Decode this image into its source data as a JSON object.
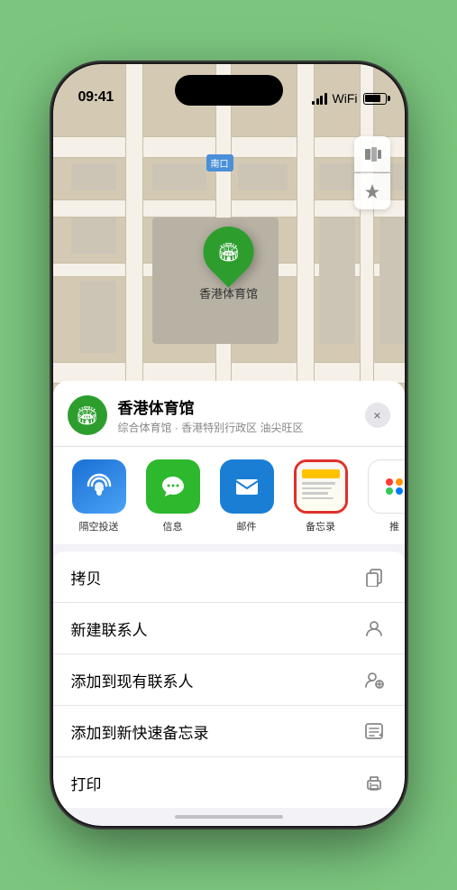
{
  "status_bar": {
    "time": "09:41",
    "location_arrow": "▶"
  },
  "map": {
    "station_label": "南口",
    "venue_name": "香港体育馆",
    "venue_label": "香港体育馆"
  },
  "sheet": {
    "venue_name": "香港体育馆",
    "venue_sub": "综合体育馆 · 香港特别行政区 油尖旺区",
    "close_label": "×"
  },
  "actions": [
    {
      "id": "airdrop",
      "label": "隔空投送",
      "emoji": "📡"
    },
    {
      "id": "messages",
      "label": "信息",
      "emoji": "💬"
    },
    {
      "id": "mail",
      "label": "邮件",
      "emoji": "✉"
    },
    {
      "id": "notes",
      "label": "备忘录",
      "emoji": "📒"
    },
    {
      "id": "more",
      "label": "推",
      "dots": true
    }
  ],
  "list_items": [
    {
      "label": "拷贝",
      "icon": "copy"
    },
    {
      "label": "新建联系人",
      "icon": "person"
    },
    {
      "label": "添加到现有联系人",
      "icon": "person-add"
    },
    {
      "label": "添加到新快速备忘录",
      "icon": "note"
    },
    {
      "label": "打印",
      "icon": "print"
    }
  ]
}
